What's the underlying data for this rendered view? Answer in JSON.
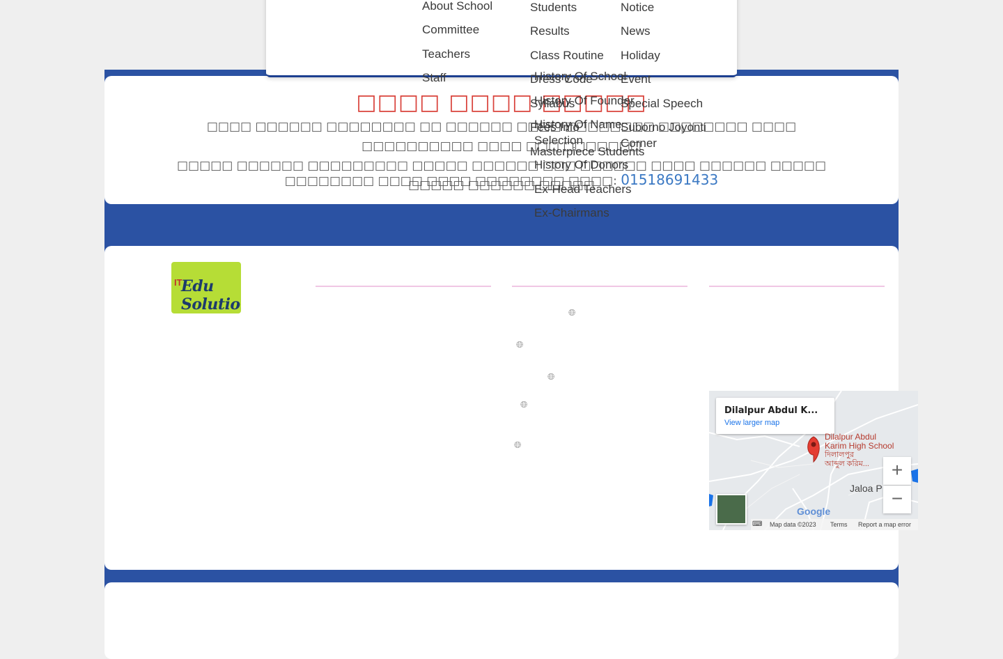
{
  "menu": {
    "col1": [
      "About School",
      "Committee",
      "Teachers",
      "Staff"
    ],
    "col2": [
      "Students",
      "Results",
      "Class Routine",
      "Dress Code",
      "Syllabus",
      "Fees Info",
      "Masterpiece Students"
    ],
    "col3": [
      "Notice",
      "News",
      "Holiday",
      "Event",
      "Special Speech",
      "Suborno Joyonti",
      "Corner"
    ],
    "about_sub": [
      "History Of School",
      "History Of Founder",
      "History Of Name",
      "Selection",
      "History Of Donors",
      "Ex-Head Teachers",
      "Ex-Chairmans"
    ]
  },
  "header": {
    "title": "□□□□ □□□□ □□□□□",
    "line1": "□□□□ □□□□□□ □□□□□□□□ □□ □□□□□□ □□□□ □□□□□□□□ □□□□□□□□ □□□□ □□□□□□□□□□ □□□□ □□□ □□□□□□□",
    "line2": "□□□□□ □□□□□□ □□□□□□□□□ □□□□□ □□□□□□ □□□ □□□□□□ □□□□ □□□□□□ □□□□□ □□□□□ □□□□□□ □□□□□",
    "contact_label": "□□□□□□□□ □□□□ □□□□ □□□□□□□□ □□□□:",
    "phone": "01518691433"
  },
  "footer": {
    "logo_text": "Edu Solution",
    "logo_mark": "IT"
  },
  "map": {
    "card_title": "Dilalpur Abdul K...",
    "card_link": "View larger map",
    "pin_label_en_1": "Dilalpur Abdul",
    "pin_label_en_2": "Karim High School",
    "pin_label_bn_1": "দিলালপুর",
    "pin_label_bn_2": "আব্দুল করিম...",
    "place": "Jaloa P",
    "google": "Google",
    "map_data": "Map data ©2023",
    "terms": "Terms",
    "report": "Report a map error",
    "zoom_in": "+",
    "zoom_out": "−"
  },
  "colors": {
    "band_blue": "#2b52a3",
    "title_red": "#d9433c",
    "phone_blue": "#3a78c3",
    "logo_green": "#b6dd36"
  }
}
